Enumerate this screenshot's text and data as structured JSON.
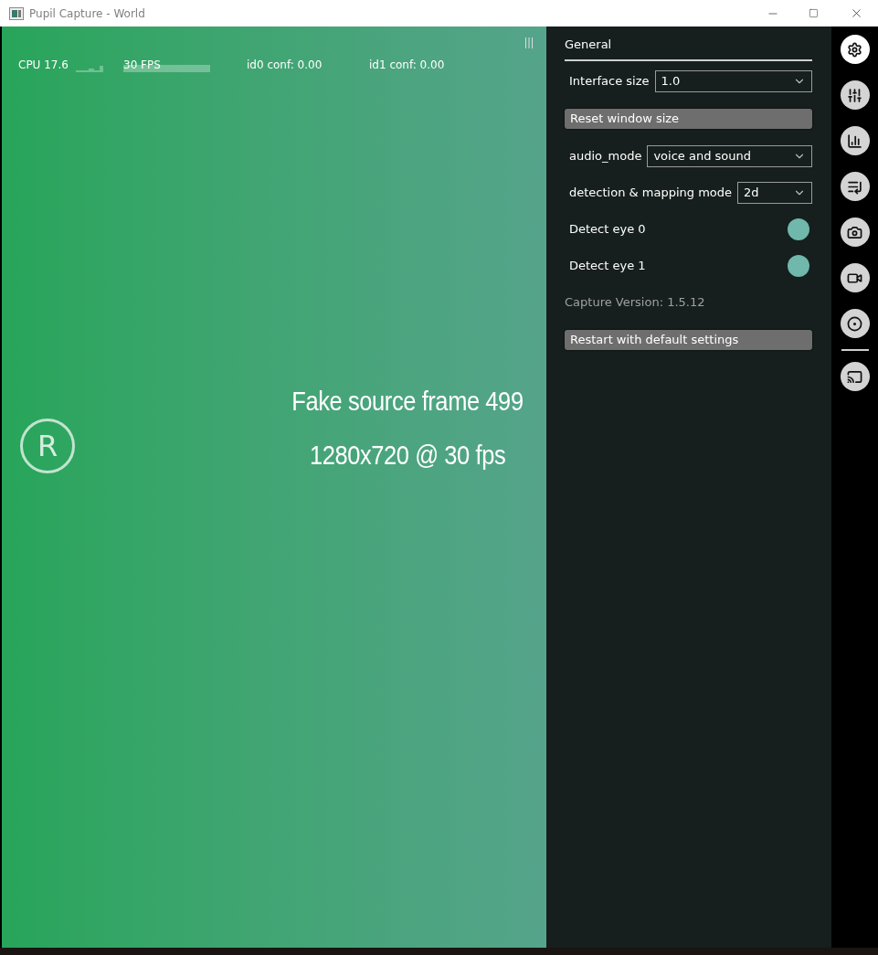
{
  "window": {
    "title": "Pupil Capture - World"
  },
  "stats": [
    {
      "kind": "graph",
      "label": "CPU 17.6"
    },
    {
      "kind": "bar",
      "label": "30 FPS"
    },
    {
      "kind": "plain",
      "label": "id0 conf: 0.00"
    },
    {
      "kind": "plain",
      "label": "id1 conf: 0.00"
    }
  ],
  "video": {
    "lines": [
      "Fake source frame 499",
      "1280x720 @ 30 fps"
    ],
    "recording_mark": "R"
  },
  "panel": {
    "title": "General",
    "items": [
      {
        "kind": "select",
        "label": "Interface size",
        "value": "1.0"
      },
      {
        "kind": "button",
        "label": "Reset window size"
      },
      {
        "kind": "select",
        "label": "audio_mode",
        "value": "voice and sound"
      },
      {
        "kind": "select",
        "label": "detection & mapping mode",
        "value": "2d"
      },
      {
        "kind": "toggle",
        "label": "Detect eye 0",
        "on": true
      },
      {
        "kind": "toggle",
        "label": "Detect eye 1",
        "on": true
      },
      {
        "kind": "info",
        "label": "Capture Version: 1.5.12"
      },
      {
        "kind": "button",
        "label": "Restart with default settings"
      }
    ]
  },
  "iconbar": [
    {
      "kind": "settings",
      "selected": true
    },
    {
      "kind": "sliders",
      "selected": false
    },
    {
      "kind": "chart",
      "selected": false
    },
    {
      "kind": "list",
      "selected": false
    },
    {
      "kind": "camera",
      "selected": false
    },
    {
      "kind": "video",
      "selected": false
    },
    {
      "kind": "target",
      "selected": false
    },
    {
      "kind": "separator"
    },
    {
      "kind": "cast",
      "selected": false
    }
  ]
}
